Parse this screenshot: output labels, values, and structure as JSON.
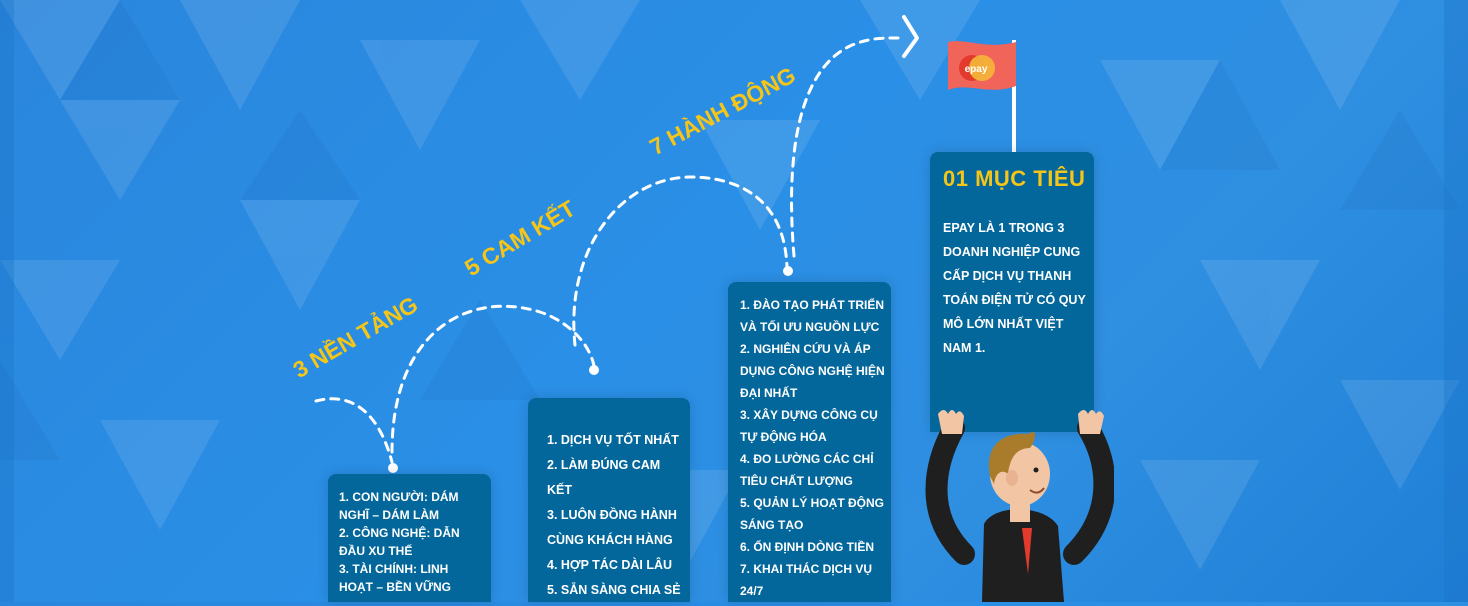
{
  "slogans": [
    "3 NỀN TẢNG",
    "5 CAM KẾT",
    "7 HÀNH ĐỘNG"
  ],
  "foundations": [
    "1. CON NGƯỜI: DÁM NGHĨ – DÁM LÀM",
    "2. CÔNG NGHỆ: DẪN ĐẦU XU THẾ",
    "3. TÀI CHÍNH: LINH HOẠT – BỀN VỮNG"
  ],
  "commitments": [
    "1. DỊCH VỤ TỐT NHẤT",
    "2. LÀM ĐÚNG CAM KẾT",
    "3. LUÔN ĐỒNG HÀNH CÙNG KHÁCH HÀNG",
    "4. HỢP TÁC DÀI LÂU",
    "5. SẴN SÀNG CHIA SẺ"
  ],
  "actions": [
    "1. ĐÀO TẠO PHÁT TRIỂN VÀ TỐI ƯU NGUỒN LỰC",
    "2. NGHIÊN CỨU VÀ ÁP DỤNG CÔNG NGHỆ HIỆN ĐẠI NHẤT",
    "3. XÂY DỰNG CÔNG CỤ TỰ ĐỘNG HÓA",
    "4. ĐO LƯỜNG CÁC CHỈ TIÊU CHẤT LƯỢNG",
    "5. QUẢN LÝ HOẠT ĐỘNG SÁNG TẠO",
    "6. ỔN ĐỊNH DÒNG TIỀN",
    "7. KHAI THÁC DỊCH VỤ 24/7"
  ],
  "goal": {
    "title": "01 MỤC TIÊU",
    "text": "EPAY LÀ 1 TRONG 3 DOANH NGHIỆP CUNG CẤP DỊCH VỤ THANH TOÁN ĐIỆN TỬ CÓ QUY MÔ LỚN NHẤT VIỆT NAM 1."
  },
  "flag": {
    "logo_text": "epay",
    "color": "#f0645a"
  },
  "colors": {
    "box": "#04679b",
    "accent": "#f5c518",
    "background": "#2a8ce2"
  }
}
